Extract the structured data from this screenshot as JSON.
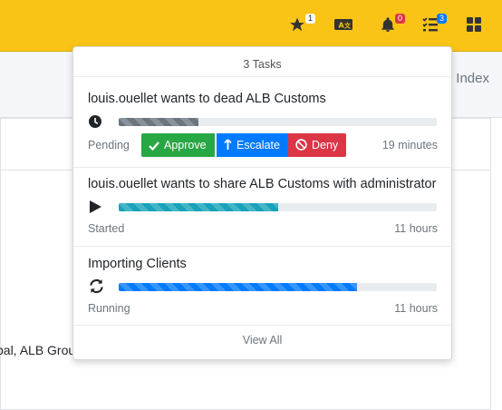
{
  "topbar": {
    "color": "#f9c416",
    "icons": [
      {
        "name": "star-icon",
        "badge": "1",
        "badge_color": "light"
      },
      {
        "name": "translate-icon",
        "badge": null
      },
      {
        "name": "bell-icon",
        "badge": "0",
        "badge_color": "red"
      },
      {
        "name": "tasks-icon",
        "badge": "3",
        "badge_color": "blue"
      },
      {
        "name": "apps-grid-icon",
        "badge": null
      }
    ],
    "star_badge": "1",
    "bell_badge": "0",
    "tasks_badge": "3"
  },
  "background": {
    "breadcrumb": "Index",
    "partial_text": "bal, ALB Grou"
  },
  "tasks_dropdown": {
    "header": "3 Tasks",
    "footer": "View All",
    "items": [
      {
        "title": "louis.ouellet wants to dead ALB Customs",
        "status_icon": "clock-icon",
        "progress": 0.25,
        "progress_color": "#6c757d",
        "status": "Pending",
        "time": "19 minutes",
        "actions": {
          "approve": "Approve",
          "escalate": "Escalate",
          "deny": "Deny"
        }
      },
      {
        "title": "louis.ouellet wants to share ALB Customs with administrator",
        "status_icon": "play-icon",
        "progress": 0.5,
        "progress_color": "#17a2b8",
        "status": "Started",
        "time": "11 hours"
      },
      {
        "title": "Importing Clients",
        "status_icon": "sync-icon",
        "progress": 0.75,
        "progress_color": "#007bff",
        "status": "Running",
        "time": "11 hours"
      }
    ]
  }
}
